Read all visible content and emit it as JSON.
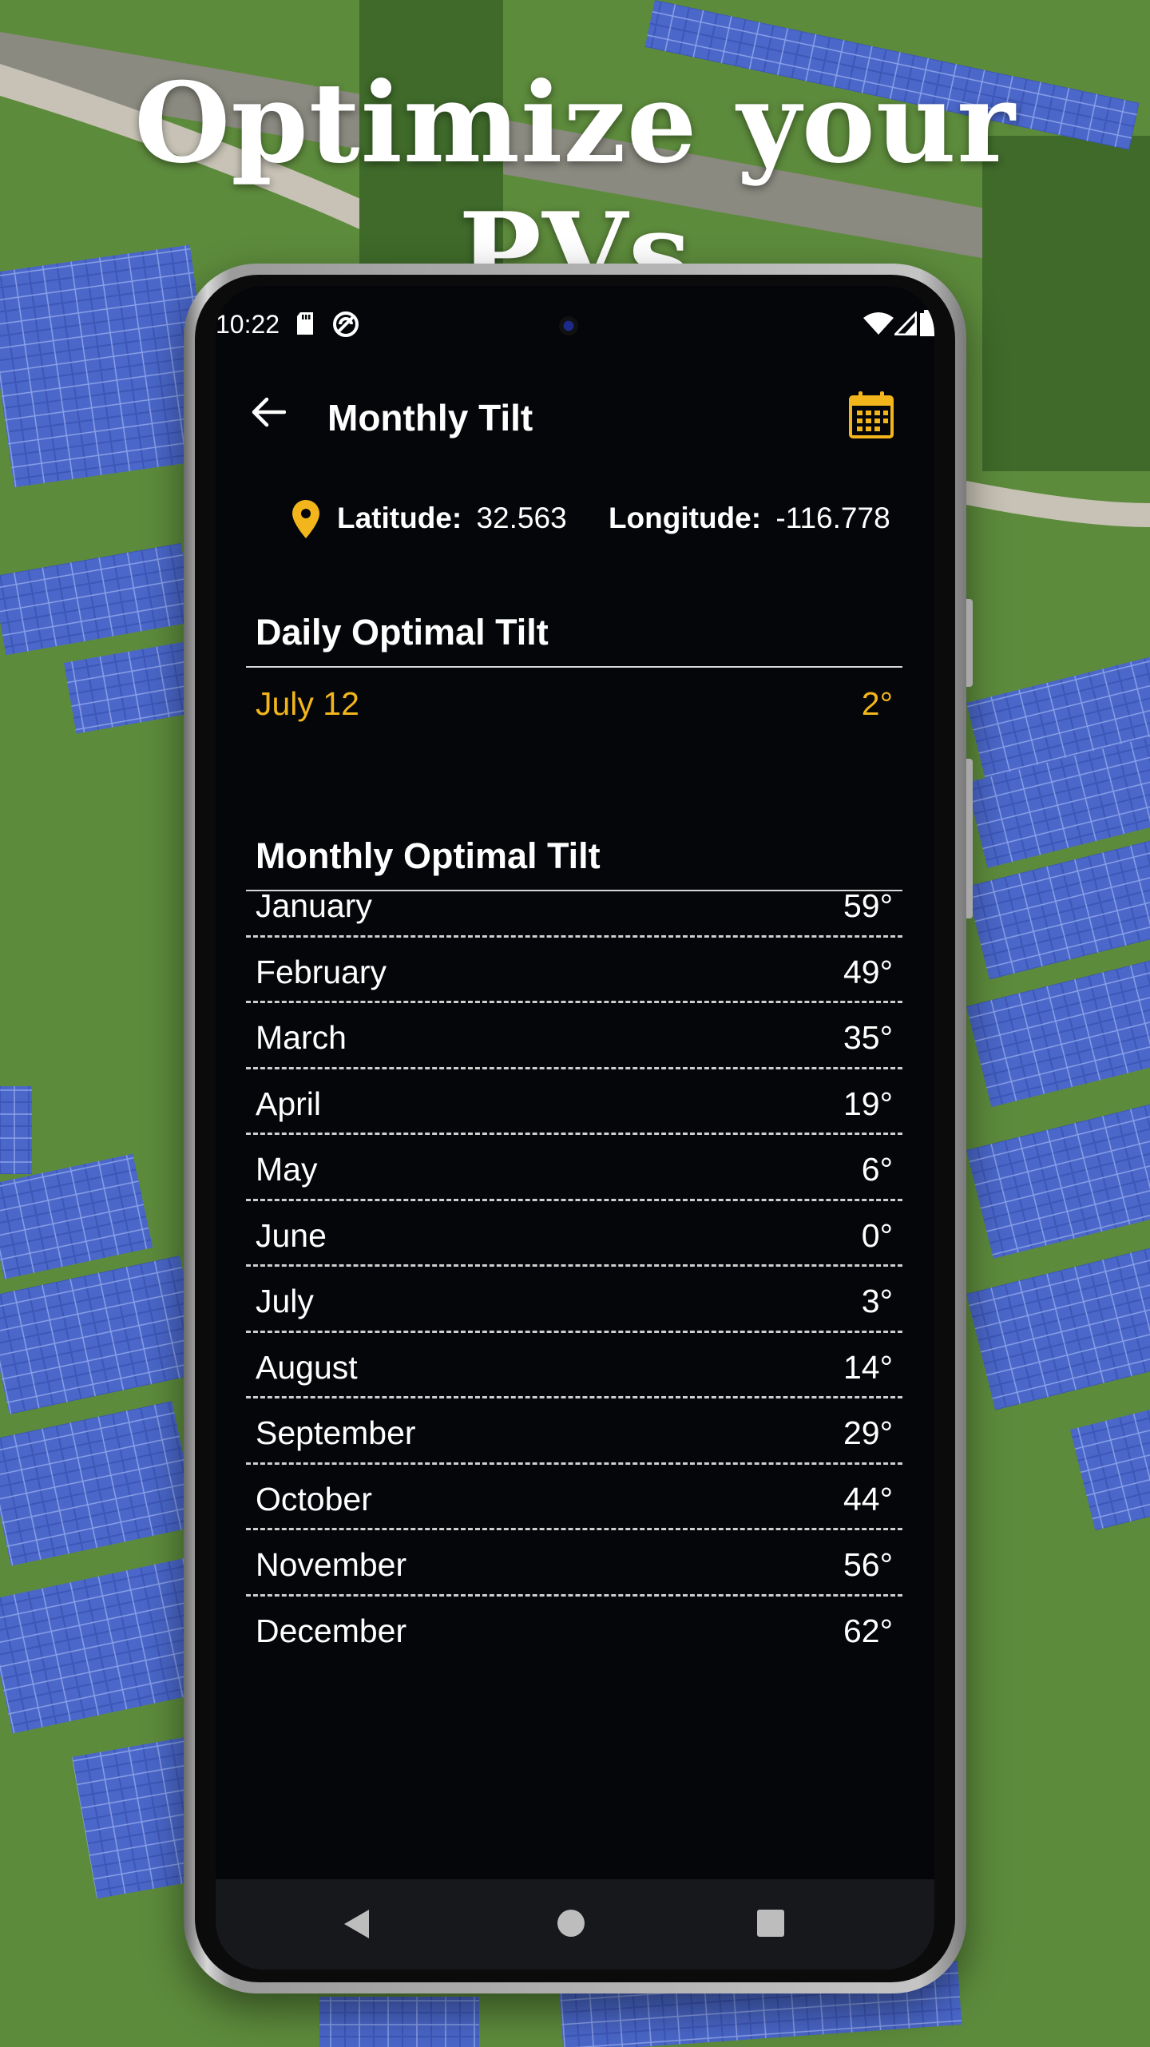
{
  "headline": "Optimize your PVs",
  "status_bar": {
    "time": "10:22"
  },
  "app_bar": {
    "title": "Monthly Tilt"
  },
  "location": {
    "latitude_label": "Latitude:",
    "latitude_value": "32.563",
    "longitude_label": "Longitude:",
    "longitude_value": "-116.778"
  },
  "daily": {
    "heading": "Daily Optimal Tilt",
    "date": "July 12",
    "value": "2°"
  },
  "monthly": {
    "heading": "Monthly Optimal Tilt",
    "rows": [
      {
        "month": "January",
        "value": "59°"
      },
      {
        "month": "February",
        "value": "49°"
      },
      {
        "month": "March",
        "value": "35°"
      },
      {
        "month": "April",
        "value": "19°"
      },
      {
        "month": "May",
        "value": "6°"
      },
      {
        "month": "June",
        "value": "0°"
      },
      {
        "month": "July",
        "value": "3°"
      },
      {
        "month": "August",
        "value": "14°"
      },
      {
        "month": "September",
        "value": "29°"
      },
      {
        "month": "October",
        "value": "44°"
      },
      {
        "month": "November",
        "value": "56°"
      },
      {
        "month": "December",
        "value": "62°"
      }
    ]
  },
  "colors": {
    "accent": "#f2b51b",
    "screen_bg": "#040609",
    "text": "#ffffff"
  }
}
